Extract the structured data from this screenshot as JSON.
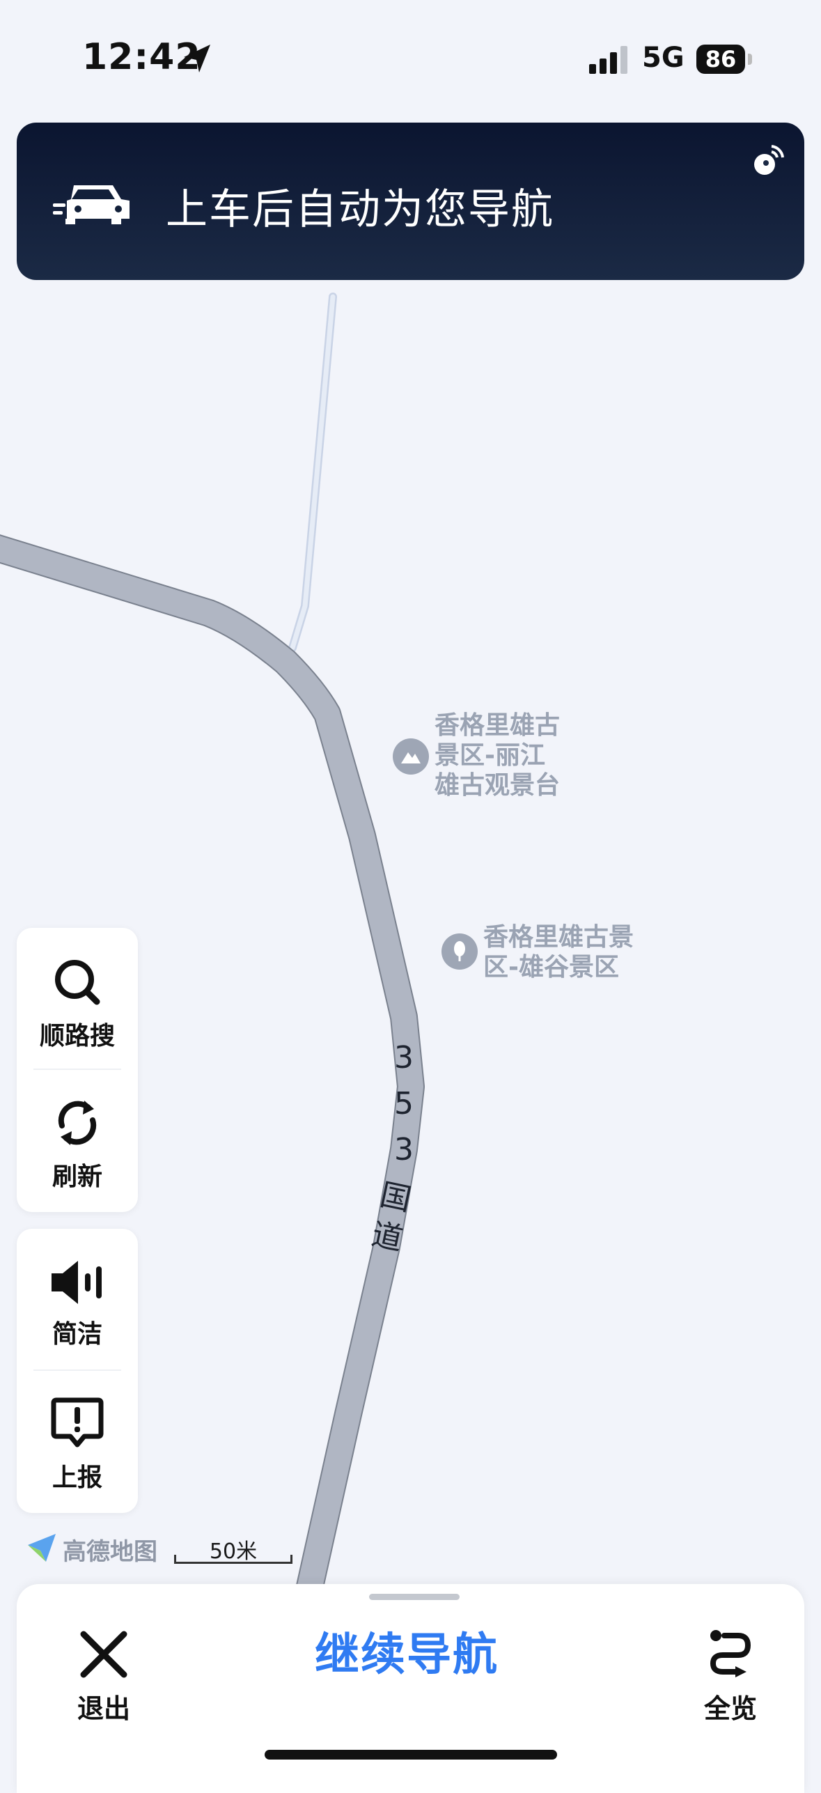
{
  "status_bar": {
    "time": "12:42",
    "network": "5G",
    "battery": "86"
  },
  "banner": {
    "message": "上车后自动为您导航"
  },
  "map": {
    "pois": [
      {
        "lines": [
          "香格里雄古",
          "景区-丽江",
          "雄古观景台"
        ]
      },
      {
        "lines": [
          "香格里雄古景",
          "区-雄谷景区"
        ]
      }
    ],
    "road_label": [
      "3",
      "5",
      "3",
      "国",
      "道"
    ],
    "brand": "高德地图",
    "scale": "50米"
  },
  "tools": {
    "search_label": "顺路搜",
    "refresh_label": "刷新",
    "concise_label": "简洁",
    "report_label": "上报"
  },
  "bottom": {
    "exit_label": "退出",
    "continue_label": "继续导航",
    "overview_label": "全览"
  },
  "colors": {
    "accent": "#2f7bf2",
    "banner_top": "#0b1530",
    "road": "#b0b6c3"
  }
}
